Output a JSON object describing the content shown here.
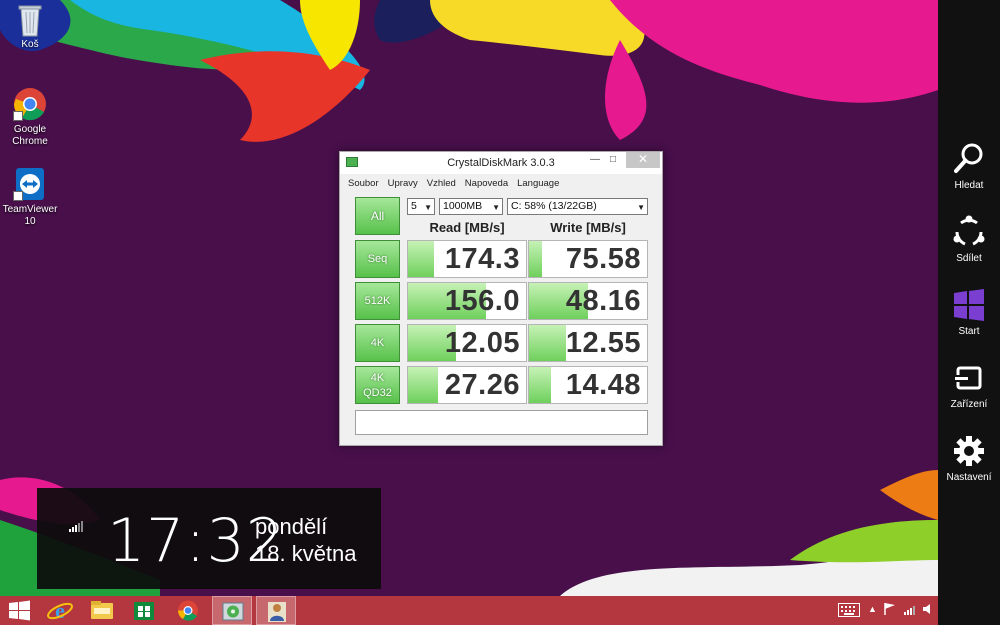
{
  "desktop": {
    "icons": [
      {
        "label": "Koš"
      },
      {
        "label": "Google Chrome"
      },
      {
        "label": "TeamViewer 10"
      }
    ]
  },
  "window": {
    "title": "CrystalDiskMark 3.0.3",
    "menu": [
      "Soubor",
      "Upravy",
      "Vzhled",
      "Napoveda",
      "Language"
    ],
    "controls": {
      "count": "5",
      "size": "1000MB",
      "drive": "C: 58% (13/22GB)"
    },
    "all_label": "All",
    "headers": {
      "read": "Read [MB/s]",
      "write": "Write [MB/s]"
    },
    "rows": [
      {
        "label": "Seq",
        "read": "174.3",
        "write": "75.58",
        "read_fill": 0.22,
        "write_fill": 0.11
      },
      {
        "label": "512K",
        "read": "156.0",
        "write": "48.16",
        "read_fill": 0.66,
        "write_fill": 0.5
      },
      {
        "label": "4K",
        "read": "12.05",
        "write": "12.55",
        "read_fill": 0.41,
        "write_fill": 0.31
      },
      {
        "label": "4K\nQD32",
        "label_line1": "4K",
        "label_line2": "QD32",
        "read": "27.26",
        "write": "14.48",
        "read_fill": 0.25,
        "write_fill": 0.19
      }
    ]
  },
  "charms": [
    {
      "label": "Hledat",
      "icon": "search-icon"
    },
    {
      "label": "Sdílet",
      "icon": "share-icon"
    },
    {
      "label": "Start",
      "icon": "windows-logo-icon"
    },
    {
      "label": "Zařízení",
      "icon": "devices-icon"
    },
    {
      "label": "Nastavení",
      "icon": "gear-icon"
    }
  ],
  "clock": {
    "time": "17:32",
    "day": "pondělí",
    "date": "18. května"
  },
  "taskbar": {
    "apps": [
      "start-button",
      "internet-explorer",
      "file-explorer",
      "store",
      "chrome",
      "crystaldiskmark",
      "teamviewer"
    ]
  },
  "colors": {
    "accent_green": "#57c14a",
    "taskbar": "#b4363f",
    "wallpaper_base": "#4a0f4a"
  }
}
